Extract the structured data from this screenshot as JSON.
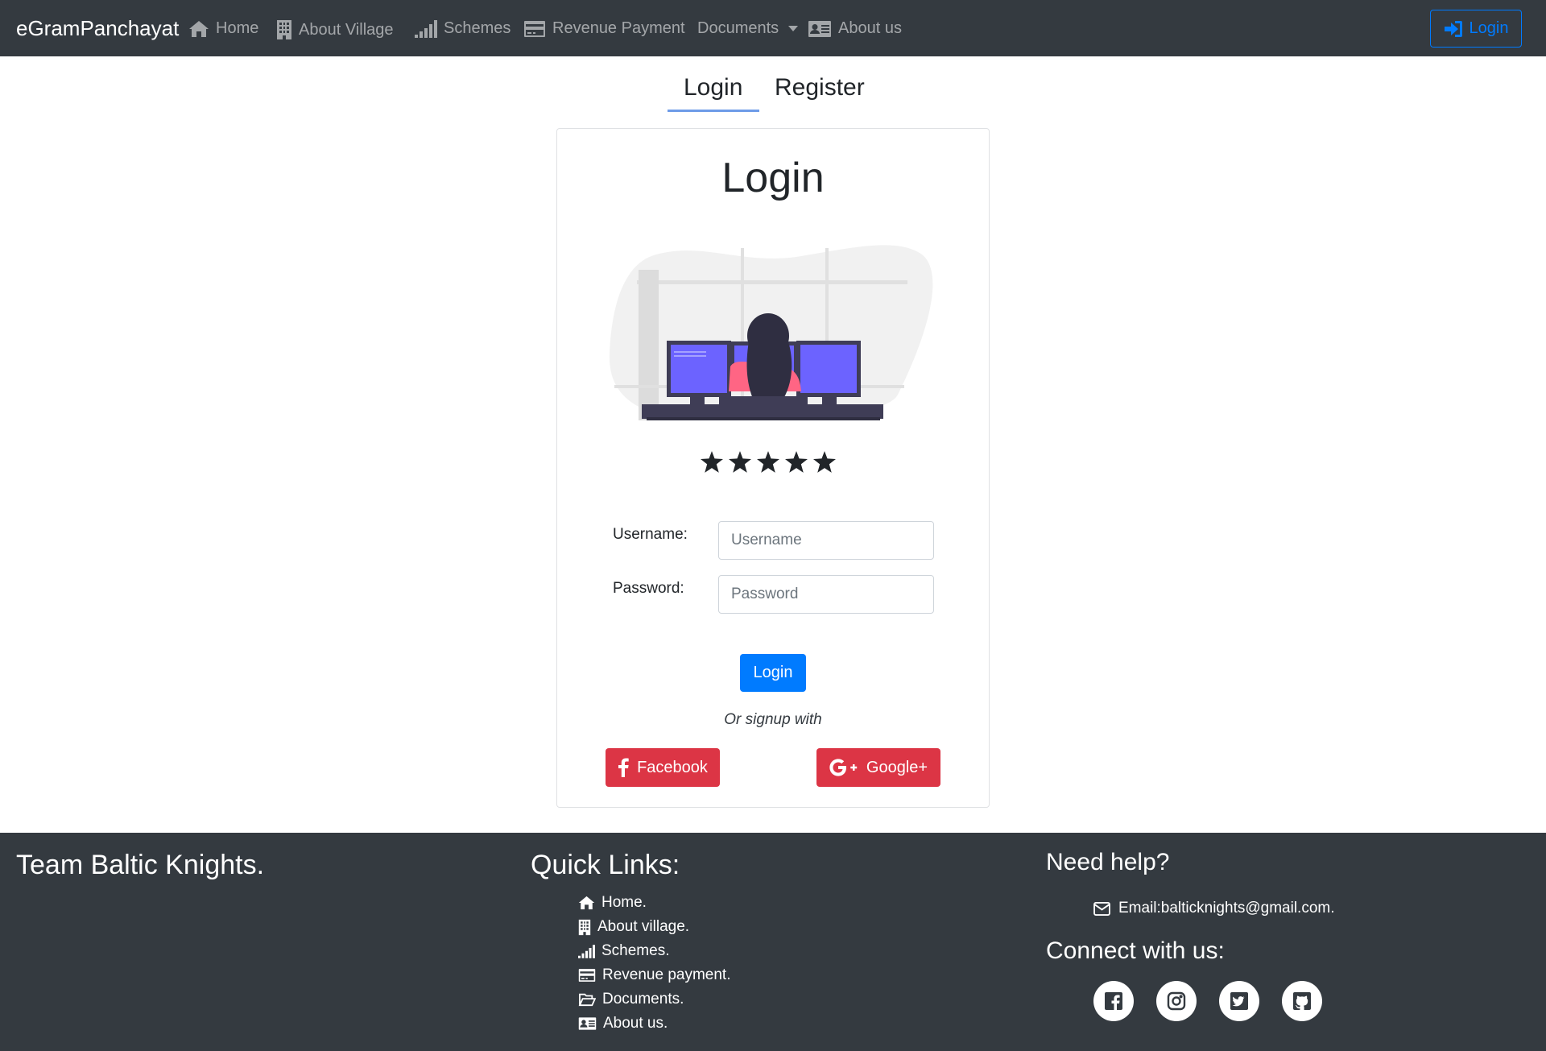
{
  "navbar": {
    "brand": "eGramPanchayat",
    "items": [
      {
        "label": "Home",
        "icon": "home-icon"
      },
      {
        "label": "About Village",
        "icon": "building-icon"
      },
      {
        "label": "Schemes",
        "icon": "signal-icon"
      },
      {
        "label": "Revenue Payment",
        "icon": "credit-card-icon"
      },
      {
        "label": "Documents",
        "icon": "chevron-down-icon"
      },
      {
        "label": "About us",
        "icon": "id-card-icon"
      }
    ],
    "login_label": "Login"
  },
  "tabs": [
    {
      "label": "Login",
      "active": true
    },
    {
      "label": "Register",
      "active": false
    }
  ],
  "card": {
    "title": "Login",
    "rating_stars": 5,
    "username_label": "Username:",
    "username_placeholder": "Username",
    "password_label": "Password:",
    "password_placeholder": "Password",
    "login_button": "Login",
    "or_text": "Or signup with",
    "facebook_label": "Facebook",
    "google_label": "Google+"
  },
  "footer": {
    "team": "Team Baltic Knights.",
    "quick_links_title": "Quick Links:",
    "links": [
      {
        "label": "Home.",
        "icon": "home-icon"
      },
      {
        "label": "About village.",
        "icon": "building-icon"
      },
      {
        "label": "Schemes.",
        "icon": "signal-icon"
      },
      {
        "label": "Revenue payment.",
        "icon": "credit-card-icon"
      },
      {
        "label": "Documents.",
        "icon": "folder-open-icon"
      },
      {
        "label": "About us.",
        "icon": "id-card-icon"
      }
    ],
    "help_title": "Need help?",
    "email": "Email:balticknights@gmail.com.",
    "connect_title": "Connect with us:",
    "social": [
      "facebook-icon",
      "instagram-icon",
      "twitter-icon",
      "github-icon"
    ]
  },
  "colors": {
    "navbar_bg": "#343a40",
    "primary": "#007bff",
    "danger": "#dc3545",
    "illustration_accent": "#6c63ff",
    "illustration_shirt": "#ff6584"
  }
}
